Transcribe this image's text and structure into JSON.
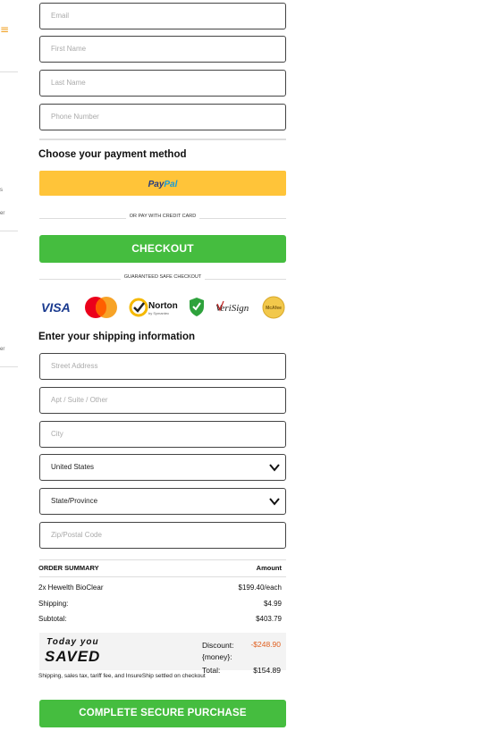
{
  "contact": {
    "email_placeholder": "Email",
    "first_name_placeholder": "First Name",
    "last_name_placeholder": "Last Name",
    "phone_placeholder": "Phone Number"
  },
  "payment": {
    "heading": "Choose your payment method",
    "paypal_part1": "Pay",
    "paypal_part2": "Pal",
    "or_text": "OR PAY WITH CREDIT CARD",
    "checkout_label": "CHECKOUT",
    "safe_text": "GUARANTEED SAFE CHECKOUT",
    "badges": {
      "visa": "VISA",
      "norton": "Norton",
      "norton_sub": "by Symantec",
      "verisign": "VeriSign",
      "mcafee": "McAfee"
    }
  },
  "shipping": {
    "heading": "Enter your shipping information",
    "street_placeholder": "Street Address",
    "apt_placeholder": "Apt / Suite / Other",
    "city_placeholder": "City",
    "country_value": "United States",
    "state_value": "State/Province",
    "zip_placeholder": "Zip/Postal Code"
  },
  "summary": {
    "title": "ORDER SUMMARY",
    "amount_header": "Amount",
    "item_label": "2x Hewelth BioClear",
    "item_value": "$199.40/each",
    "shipping_label": "Shipping:",
    "shipping_value": "$4.99",
    "subtotal_label": "Subtotal:",
    "subtotal_value": "$403.79",
    "today_you": "Today you",
    "saved": "SAVED",
    "discount_label": "Discount:",
    "discount_money": "{money}:",
    "discount_value": "-$248.90",
    "total_label": "Total:",
    "total_value": "$154.89",
    "footnote": "Shipping, sales tax, tariff fee, and InsureShip settled on checkout"
  },
  "purchase": {
    "label": "COMPLETE SECURE PURCHASE"
  },
  "colors": {
    "green": "#45bd3f",
    "paypal_yellow": "#ffc439",
    "discount_orange": "#e06020"
  }
}
